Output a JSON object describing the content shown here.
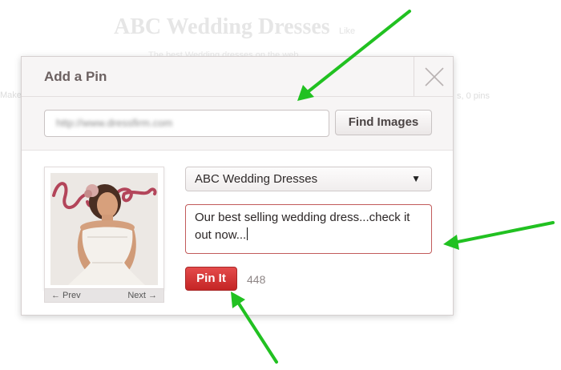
{
  "background": {
    "title": "ABC Wedding Dresses",
    "like": "Like",
    "subtitle": "The best Wedding dresses on the web",
    "left_text": "Make",
    "right_text": "s, 0 pins"
  },
  "dialog": {
    "title": "Add a Pin",
    "close_icon": "close-icon"
  },
  "url_field": {
    "value": "http://www.dressfirm.com"
  },
  "find_images_label": "Find Images",
  "board_select": {
    "selected": "ABC Wedding Dresses",
    "arrow": "▼"
  },
  "description": {
    "value": "Our best selling wedding dress...check it out now..."
  },
  "pin_button_label": "Pin It",
  "char_count": "448",
  "thumbnail_nav": {
    "prev": "← Prev",
    "next": "Next →"
  },
  "annotations": {
    "arrow_color": "#21c121"
  },
  "colors": {
    "accent": "#d43535",
    "header_bg": "#f7f5f5"
  }
}
